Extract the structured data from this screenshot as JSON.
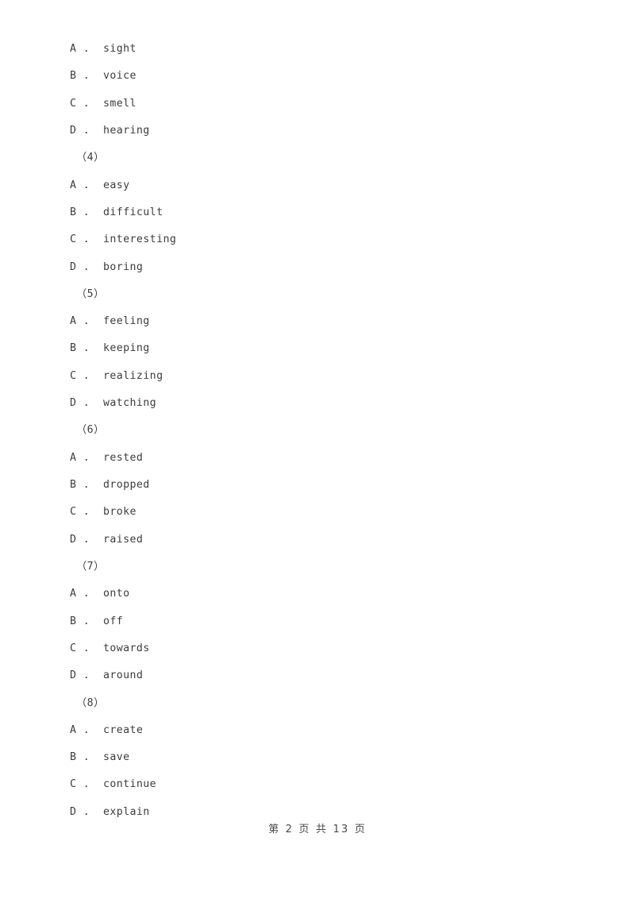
{
  "document": {
    "page_label": "第 2 页 共 13 页",
    "page_number": "2",
    "total_pages": "13",
    "text_color": "#3c3c3c",
    "background_color": "#ffffff"
  },
  "blocks": [
    {
      "question_number": "",
      "options": [
        {
          "letter": "A",
          "separator": " .",
          "text": "sight"
        },
        {
          "letter": "B",
          "separator": " .",
          "text": "voice"
        },
        {
          "letter": "C",
          "separator": " .",
          "text": "smell"
        },
        {
          "letter": "D",
          "separator": " .",
          "text": "hearing"
        }
      ]
    },
    {
      "question_number": "（4）",
      "options": [
        {
          "letter": "A",
          "separator": " .",
          "text": "easy"
        },
        {
          "letter": "B",
          "separator": " .",
          "text": "difficult"
        },
        {
          "letter": "C",
          "separator": " .",
          "text": "interesting"
        },
        {
          "letter": "D",
          "separator": " .",
          "text": "boring"
        }
      ]
    },
    {
      "question_number": "（5）",
      "options": [
        {
          "letter": "A",
          "separator": " .",
          "text": "feeling"
        },
        {
          "letter": "B",
          "separator": " .",
          "text": "keeping"
        },
        {
          "letter": "C",
          "separator": " .",
          "text": "realizing"
        },
        {
          "letter": "D",
          "separator": " .",
          "text": "watching"
        }
      ]
    },
    {
      "question_number": "（6）",
      "options": [
        {
          "letter": "A",
          "separator": " .",
          "text": "rested"
        },
        {
          "letter": "B",
          "separator": " .",
          "text": "dropped"
        },
        {
          "letter": "C",
          "separator": " .",
          "text": "broke"
        },
        {
          "letter": "D",
          "separator": " .",
          "text": "raised"
        }
      ]
    },
    {
      "question_number": "（7）",
      "options": [
        {
          "letter": "A",
          "separator": " .",
          "text": "onto"
        },
        {
          "letter": "B",
          "separator": " .",
          "text": "off"
        },
        {
          "letter": "C",
          "separator": " .",
          "text": "towards"
        },
        {
          "letter": "D",
          "separator": " .",
          "text": "around"
        }
      ]
    },
    {
      "question_number": "（8）",
      "options": [
        {
          "letter": "A",
          "separator": " .",
          "text": "create"
        },
        {
          "letter": "B",
          "separator": " .",
          "text": "save"
        },
        {
          "letter": "C",
          "separator": " .",
          "text": "continue"
        },
        {
          "letter": "D",
          "separator": " .",
          "text": "explain"
        }
      ]
    }
  ]
}
